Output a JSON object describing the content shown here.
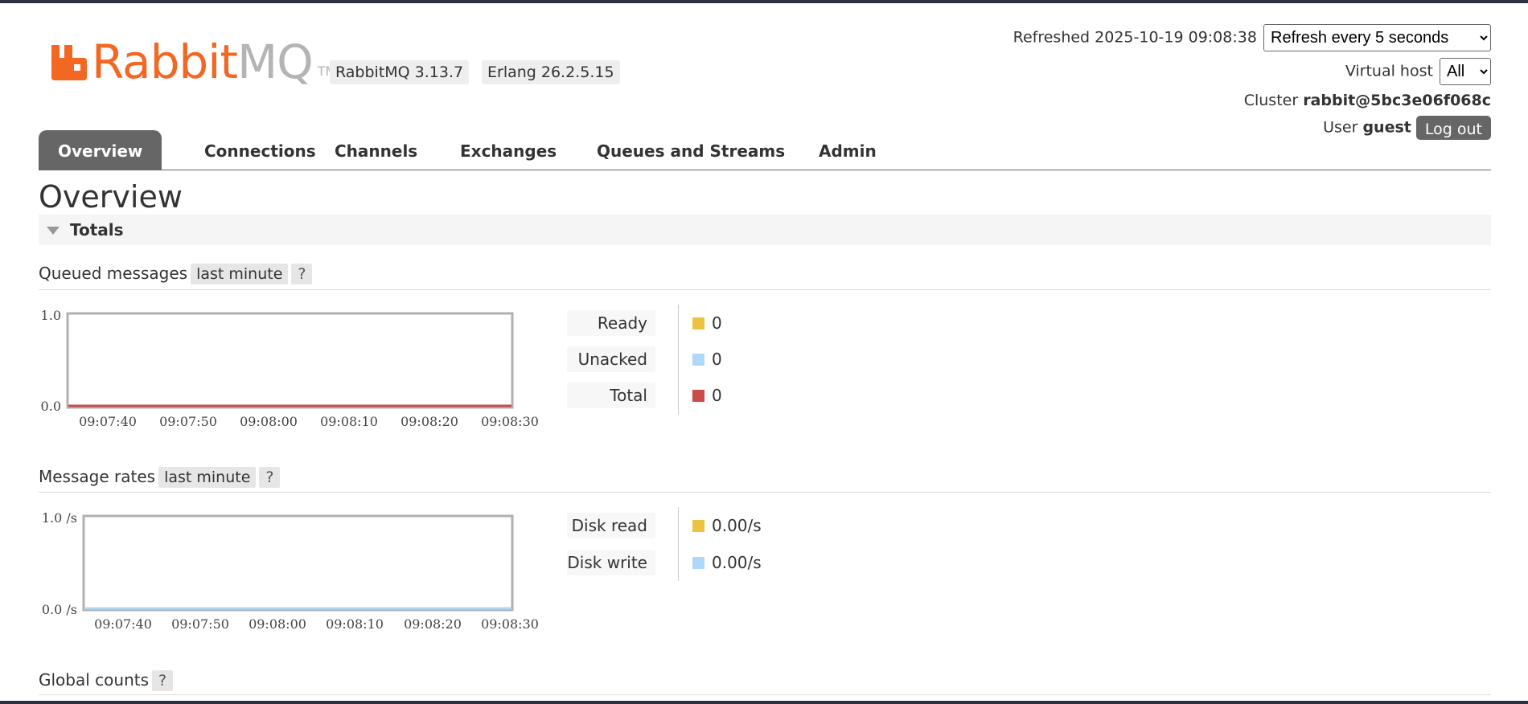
{
  "brand": {
    "rabbit": "Rabbit",
    "mq": "MQ",
    "tm": "TM",
    "color_primary": "#f26722",
    "color_secondary": "#b4b4b4"
  },
  "versions": {
    "rabbitmq": "RabbitMQ 3.13.7",
    "erlang": "Erlang 26.2.5.15"
  },
  "header": {
    "refreshed_label": "Refreshed 2025-10-19 09:08:38",
    "refresh_select": "Refresh every 5 seconds",
    "vhost_label": "Virtual host",
    "vhost_select": "All",
    "cluster_label": "Cluster",
    "cluster_name": "rabbit@5bc3e06f068c",
    "user_label": "User",
    "user_name": "guest",
    "logout_label": "Log out"
  },
  "tabs": [
    {
      "label": "Overview",
      "active": true
    },
    {
      "label": "Connections"
    },
    {
      "label": "Channels"
    },
    {
      "label": "Exchanges"
    },
    {
      "label": "Queues and Streams"
    },
    {
      "label": "Admin"
    }
  ],
  "page_title": "Overview",
  "totals": {
    "label": "Totals",
    "queued": {
      "title": "Queued messages",
      "range": "last minute",
      "help": "?",
      "y_ticks": [
        "1.0",
        "0.0"
      ],
      "x_ticks": [
        "09:07:40",
        "09:07:50",
        "09:08:00",
        "09:08:10",
        "09:08:20",
        "09:08:30"
      ],
      "legend": [
        {
          "label": "Ready",
          "value": "0",
          "color": "#edc240"
        },
        {
          "label": "Unacked",
          "value": "0",
          "color": "#afd8f8"
        },
        {
          "label": "Total",
          "value": "0",
          "color": "#cb4b4b"
        }
      ]
    },
    "rates": {
      "title": "Message rates",
      "range": "last minute",
      "help": "?",
      "y_ticks": [
        "1.0 /s",
        "0.0 /s"
      ],
      "x_ticks": [
        "09:07:40",
        "09:07:50",
        "09:08:00",
        "09:08:10",
        "09:08:20",
        "09:08:30"
      ],
      "legend": [
        {
          "label": "Disk read",
          "value": "0.00/s",
          "color": "#edc240"
        },
        {
          "label": "Disk write",
          "value": "0.00/s",
          "color": "#afd8f8"
        }
      ]
    },
    "global": {
      "title": "Global counts",
      "help": "?"
    }
  }
}
